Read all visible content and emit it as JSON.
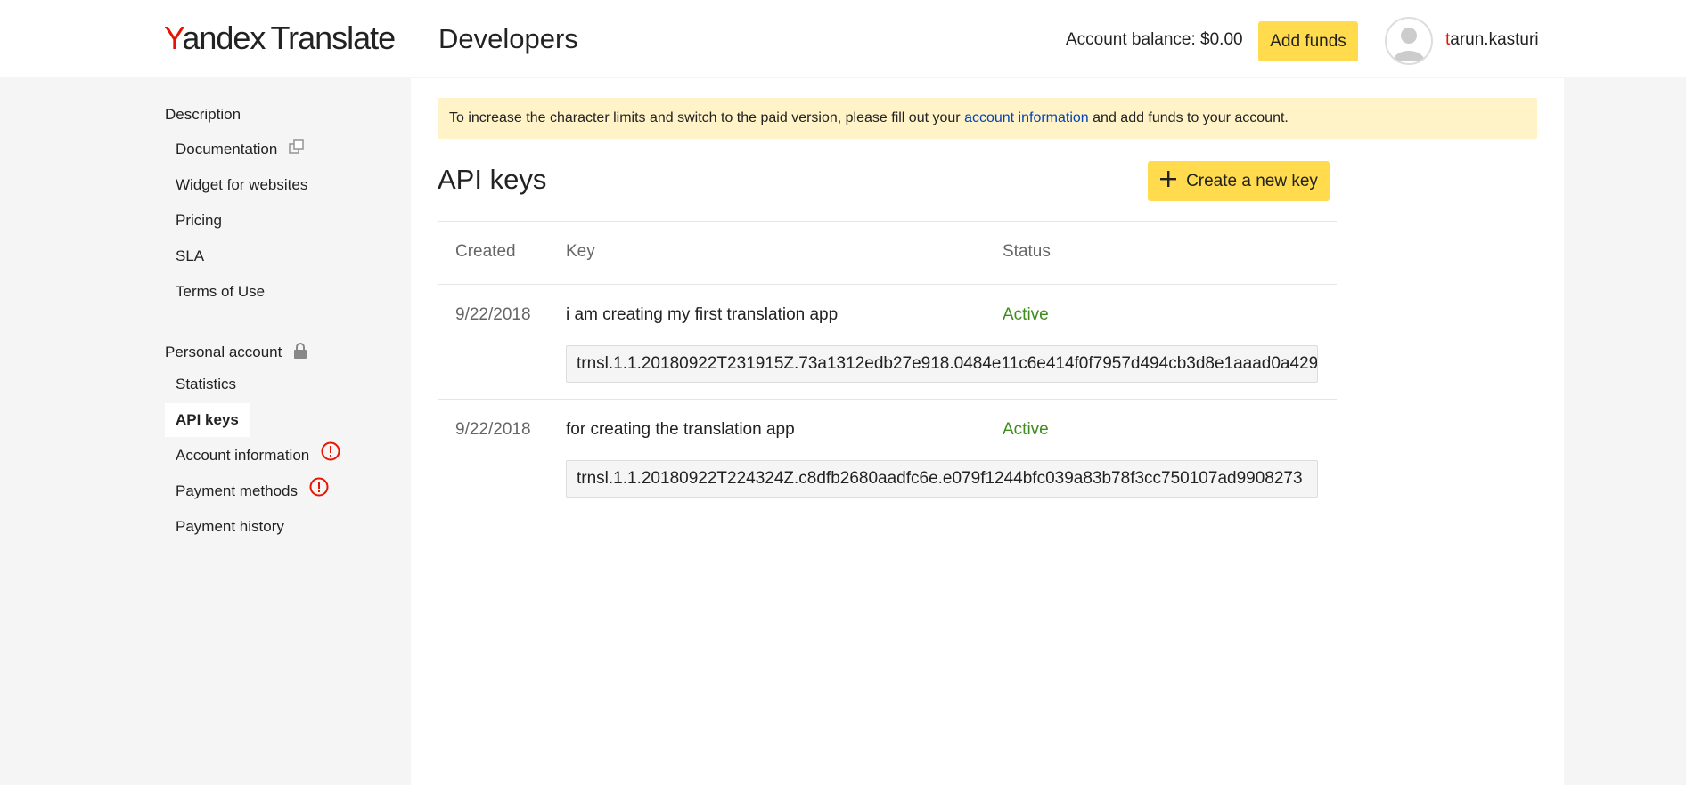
{
  "header": {
    "logo_brand_first": "Y",
    "logo_brand_rest": "andex",
    "logo_product": "Translate",
    "page_title": "Developers",
    "balance": "Account balance: $0.00",
    "add_funds_label": "Add funds",
    "username_first": "t",
    "username_rest": "arun.kasturi"
  },
  "sidebar": {
    "description_heading": "Description",
    "description_items": [
      "Documentation",
      "Widget for websites",
      "Pricing",
      "SLA",
      "Terms of Use"
    ],
    "personal_heading": "Personal account",
    "personal_items": [
      "Statistics",
      "API keys",
      "Account information",
      "Payment methods",
      "Payment history"
    ],
    "active_item": "API keys"
  },
  "main": {
    "notice_before": "To increase the character limits and switch to the paid version, please fill out your ",
    "notice_link": "account information",
    "notice_after": " and add funds to your account.",
    "section_title": "API keys",
    "create_key_label": "Create a new key",
    "columns": [
      "Created",
      "Key",
      "Status"
    ],
    "keys": [
      {
        "created": "9/22/2018",
        "name": "i am creating my first translation app",
        "status": "Active",
        "key": "trnsl.1.1.20180922T231915Z.73a1312edb27e918.0484e11c6e414f0f7957d494cb3d8e1aaad0a429"
      },
      {
        "created": "9/22/2018",
        "name": "for creating the translation app",
        "status": "Active",
        "key": "trnsl.1.1.20180922T224324Z.c8dfb2680aadfc6e.e079f1244bfc039a83b78f3cc750107ad9908273"
      }
    ]
  },
  "colors": {
    "accent_yellow": "#ffdb4d",
    "brand_red": "#e61400",
    "link_blue": "#0044bb",
    "status_green": "#408c1e",
    "notice_bg": "#fff3c7",
    "warning_red": "#e61400"
  },
  "icons": {
    "documentation": "external-link-icon",
    "personal_account": "lock-icon",
    "account_information": "warning-icon",
    "payment_methods": "warning-icon",
    "create_key": "plus-icon",
    "avatar": "user-avatar-icon"
  }
}
